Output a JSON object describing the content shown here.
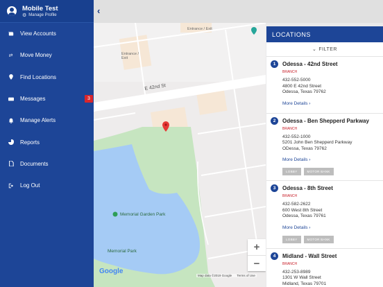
{
  "profile": {
    "name": "Mobile Test",
    "manage_label": "Manage Profile"
  },
  "nav": [
    {
      "label": "View Accounts",
      "icon": "accounts-icon"
    },
    {
      "label": "Move Money",
      "icon": "transfer-icon"
    },
    {
      "label": "Find Locations",
      "icon": "pin-icon"
    },
    {
      "label": "Messages",
      "icon": "envelope-icon",
      "badge": "3"
    },
    {
      "label": "Manage Alerts",
      "icon": "bell-icon"
    },
    {
      "label": "Reports",
      "icon": "chart-icon"
    },
    {
      "label": "Documents",
      "icon": "document-icon"
    },
    {
      "label": "Log Out",
      "icon": "logout-icon"
    }
  ],
  "map": {
    "street": "E 42nd St",
    "entrance_1": "Entrance / Exit",
    "entrance_2": "Entrance / Exit",
    "park_1": "Memorial Garden Park",
    "park_2": "Memorial Park",
    "google": "Google",
    "attribution": "Map data ©2019 Google",
    "terms": "Terms of Use"
  },
  "locations_panel": {
    "title": "LOCATIONS",
    "filter_label": "FILTER",
    "items": [
      {
        "num": "1",
        "name": "Odessa - 42nd Street",
        "type": "BRANCH",
        "phone": "432-552-5000",
        "address1": "4800 E 42nd Street",
        "address2": "Odessa, Texas 79762",
        "more": "More Details",
        "tags": []
      },
      {
        "num": "2",
        "name": "Odessa - Ben Shepperd Parkway",
        "type": "BRANCH",
        "phone": "432-552-1000",
        "address1": "5201 John Ben Shepperd Parkway",
        "address2": "ODessa, Texas 79762",
        "more": "More Details",
        "tags": [
          "LOBBY",
          "MOTOR BANK"
        ]
      },
      {
        "num": "3",
        "name": "Odessa - 8th Street",
        "type": "BRANCH",
        "phone": "432-582-2622",
        "address1": "600 West 8th Street",
        "address2": "Odessa, Texas 79761",
        "more": "More Details",
        "tags": [
          "LOBBY",
          "MOTOR BANK"
        ]
      },
      {
        "num": "4",
        "name": "Midland - Wall Street",
        "type": "BRANCH",
        "phone": "432-253-8989",
        "address1": "1301 W Wall Street",
        "address2": "Midland, Texas 79701",
        "more": "",
        "tags": []
      }
    ]
  },
  "colors": {
    "primary": "#1d4597",
    "badge": "#d9262c",
    "branch_red": "#c8202a",
    "water": "#a5cbf5",
    "park": "#b7e0b4"
  }
}
